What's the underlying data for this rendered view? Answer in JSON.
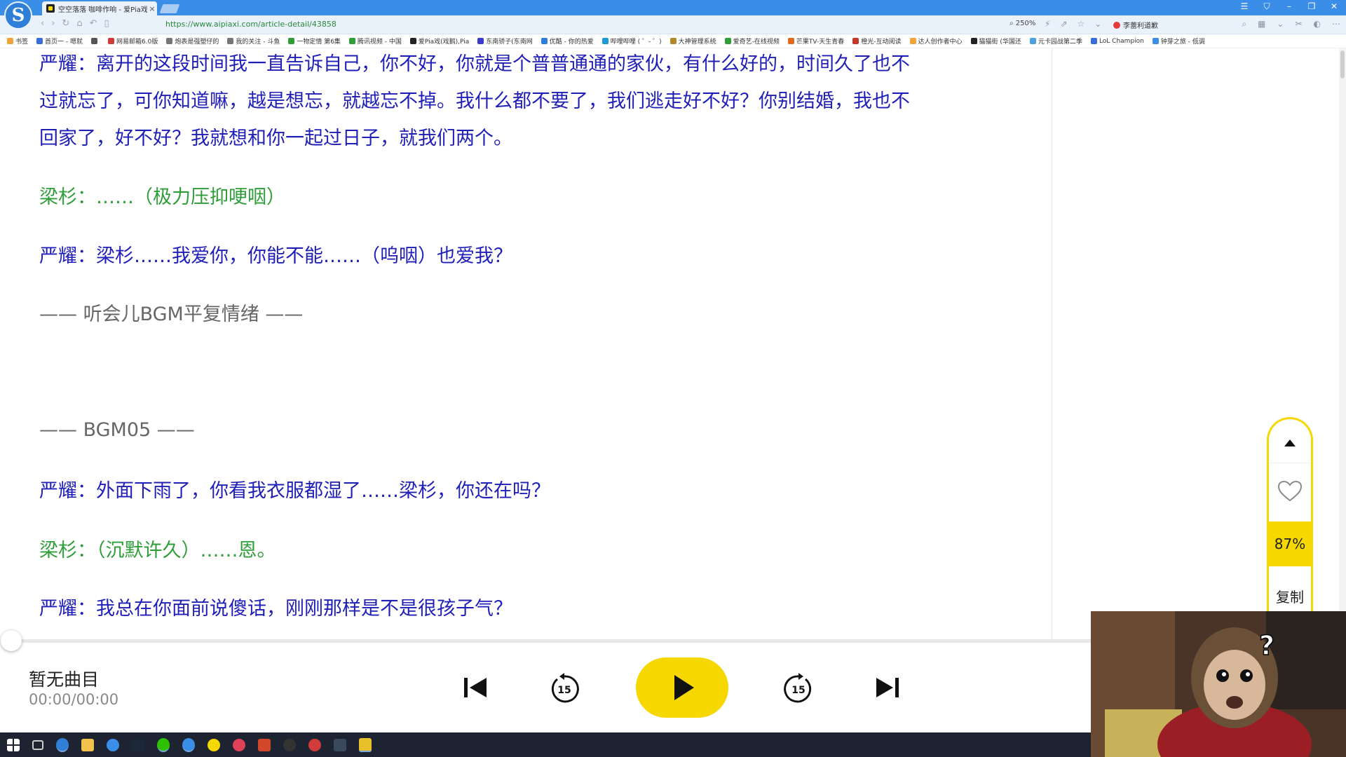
{
  "browser": {
    "tab_title": "空空落落 咖啡作响 - 爱Pia戏问",
    "tab_close": "×",
    "url": "https://www.aipiaxi.com/article-detail/43858",
    "zoom": "250%",
    "user_name": "李蕾利道歉",
    "window_controls": [
      "☰",
      "⛉",
      "–",
      "❐",
      "✕"
    ],
    "nav_icons": [
      "‹",
      "›",
      "↻",
      "⌂",
      "↶",
      "▯"
    ],
    "addr_icons": [
      "⚡",
      "⇗",
      "☆",
      "⌄"
    ],
    "addr_far_icons": [
      "⌕",
      "▦",
      "⌄",
      "✂",
      "◐",
      "⋯"
    ],
    "bookmarks": [
      {
        "label": "书签",
        "color": "#f2a33a"
      },
      {
        "label": "首页一 - 嗯就",
        "color": "#3b6fd8"
      },
      {
        "label": "",
        "color": "#555555"
      },
      {
        "label": "网易邮箱6.0版",
        "color": "#d23b3b"
      },
      {
        "label": "炮表是强塑仔的",
        "color": "#777777"
      },
      {
        "label": "我的关注 - 斗鱼",
        "color": "#777777"
      },
      {
        "label": "一物定情 第6集",
        "color": "#2e9e38"
      },
      {
        "label": "腾讯视频 - 中国",
        "color": "#2e9e38"
      },
      {
        "label": "爱Pia戏(戏鹅),Pia",
        "color": "#222222"
      },
      {
        "label": "东南骄子(东南网",
        "color": "#3b3bd0"
      },
      {
        "label": "优酷 - 你的热爱",
        "color": "#2f7fd8"
      },
      {
        "label": "哔哩哔哩 ( ゜- ゜)",
        "color": "#1c9ad6"
      },
      {
        "label": "大神管理系统",
        "color": "#b08a2a"
      },
      {
        "label": "爱奇艺-在线视频",
        "color": "#2e9e38"
      },
      {
        "label": "芒果TV-天生青春",
        "color": "#e06a1e"
      },
      {
        "label": "橙光-互动阅读",
        "color": "#c0392b"
      },
      {
        "label": "达人创作者中心",
        "color": "#f2a33a"
      },
      {
        "label": "猫猫街 (华国还",
        "color": "#222222"
      },
      {
        "label": "元卡园战第二季",
        "color": "#4aa3e0"
      },
      {
        "label": "LoL Champion",
        "color": "#3b6fd8"
      },
      {
        "label": "钟芽之旅 - 低调",
        "color": "#3b8ee8"
      }
    ]
  },
  "article": {
    "lines": [
      {
        "text": "严耀：离开的这段时间我一直告诉自己，你不好，你就是个普普通通的家伙，有什么好的，时间久了也不",
        "color": "blue"
      },
      {
        "text": "过就忘了，可你知道嘛，越是想忘，就越忘不掉。我什么都不要了，我们逃走好不好？你别结婚，我也不",
        "color": "blue"
      },
      {
        "text": "回家了，好不好？我就想和你一起过日子，就我们两个。",
        "color": "blue"
      },
      {
        "text": "梁杉：……（极力压抑哽咽）",
        "color": "green"
      },
      {
        "text": "严耀：梁杉……我爱你，你能不能……（呜咽）也爱我？",
        "color": "blue"
      },
      {
        "text": "—— 听会儿BGM平复情绪 ——",
        "color": "gray"
      },
      {
        "text": "—— BGM05 ——",
        "color": "gray"
      },
      {
        "text": "严耀：外面下雨了，你看我衣服都湿了……梁杉，你还在吗？",
        "color": "blue"
      },
      {
        "text": "梁杉：（沉默许久）……恩。",
        "color": "green"
      },
      {
        "text": "严耀：我总在你面前说傻话，刚刚那样是不是很孩子气？",
        "color": "blue"
      }
    ]
  },
  "float_tool": {
    "percent": "87%",
    "copy_label": "复制"
  },
  "player": {
    "track_name": "暂无曲目",
    "time": "00:00/00:00",
    "skip_back_seconds": "15",
    "skip_forward_seconds": "15",
    "progress": 0
  },
  "colors": {
    "accent": "#f6d700",
    "dialog_blue": "#1f1fb8",
    "dialog_green": "#2e9e38",
    "browser_blue": "#3b8ee8"
  }
}
